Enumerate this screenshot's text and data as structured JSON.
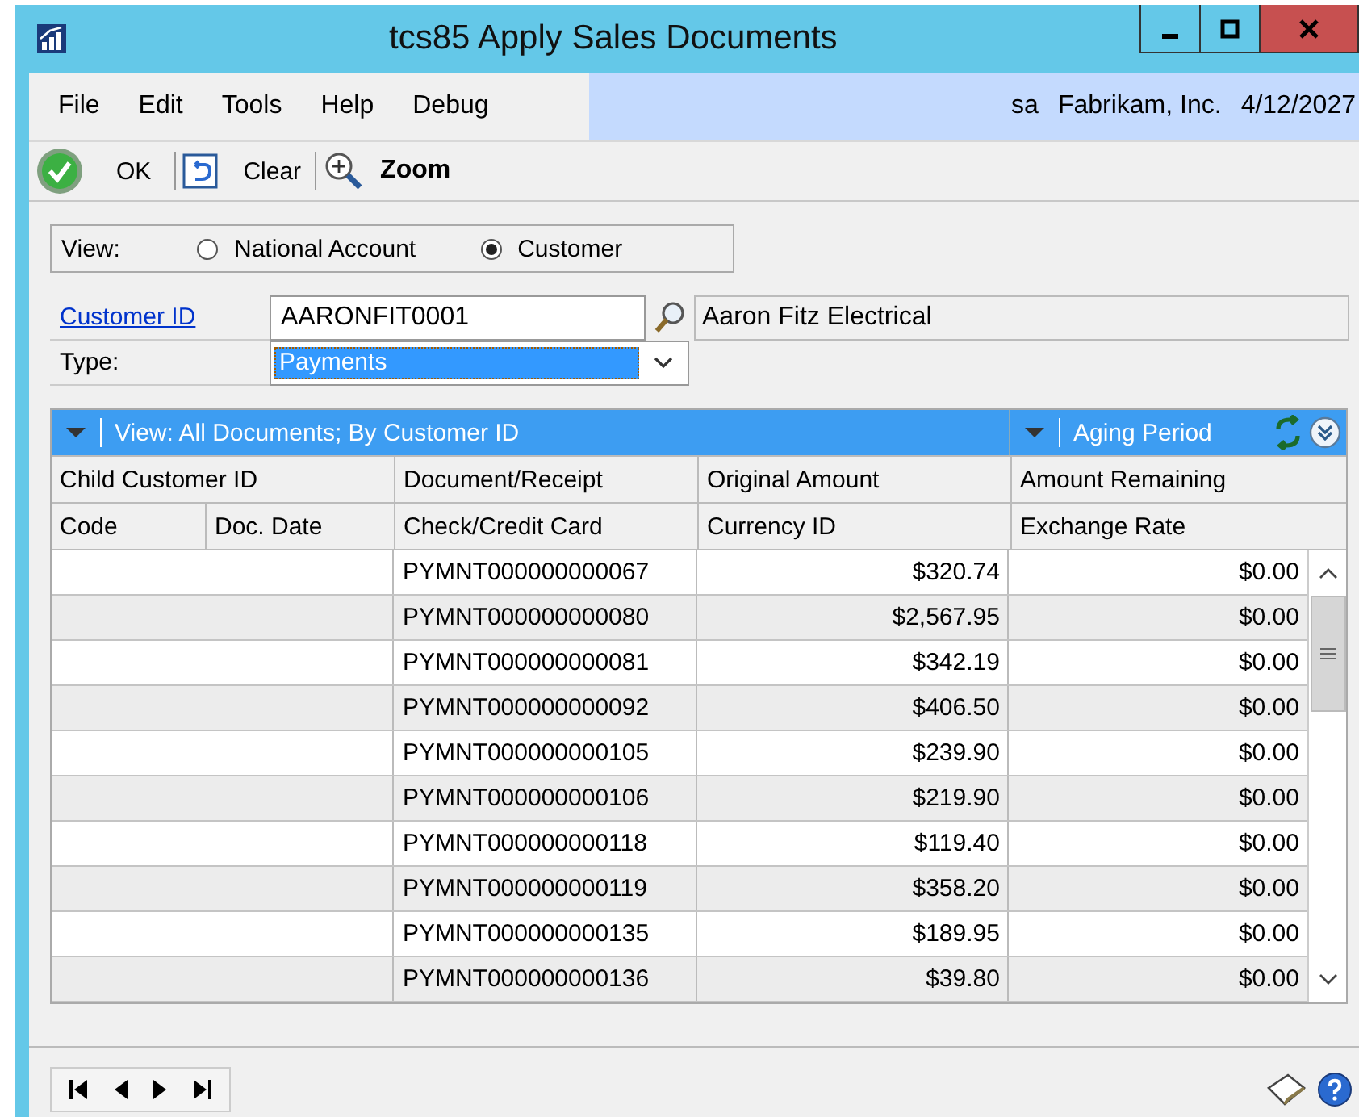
{
  "window": {
    "title": "tcs85 Apply Sales Documents"
  },
  "menu": [
    "File",
    "Edit",
    "Tools",
    "Help",
    "Debug"
  ],
  "status": {
    "user": "sa",
    "company": "Fabrikam, Inc.",
    "date": "4/12/2027"
  },
  "toolbar": [
    {
      "kind": "ok",
      "label": "OK"
    },
    {
      "kind": "clear",
      "label": "Clear"
    },
    {
      "kind": "zoom",
      "label": "Zoom"
    }
  ],
  "view": {
    "label": "View:",
    "options": [
      {
        "label": "National Account",
        "selected": false
      },
      {
        "label": "Customer",
        "selected": true
      }
    ]
  },
  "customer": {
    "label": "Customer ID",
    "value": "AARONFIT0001",
    "name": "Aaron Fitz Electrical"
  },
  "type": {
    "label": "Type:",
    "value": "Payments"
  },
  "grid": {
    "view_label": "View: All Documents; By Customer ID",
    "aging_label": "Aging Period",
    "header_1": [
      "Child Customer ID",
      "Document/Receipt",
      "Original Amount",
      "Amount Remaining"
    ],
    "header_2": [
      "Code",
      "Doc. Date",
      "Check/Credit Card",
      "Currency ID",
      "Exchange Rate"
    ],
    "rows": [
      {
        "document": "PYMNT000000000067",
        "original": "$320.74",
        "remaining": "$0.00"
      },
      {
        "document": "PYMNT000000000080",
        "original": "$2,567.95",
        "remaining": "$0.00"
      },
      {
        "document": "PYMNT000000000081",
        "original": "$342.19",
        "remaining": "$0.00"
      },
      {
        "document": "PYMNT000000000092",
        "original": "$406.50",
        "remaining": "$0.00"
      },
      {
        "document": "PYMNT000000000105",
        "original": "$239.90",
        "remaining": "$0.00"
      },
      {
        "document": "PYMNT000000000106",
        "original": "$219.90",
        "remaining": "$0.00"
      },
      {
        "document": "PYMNT000000000118",
        "original": "$119.40",
        "remaining": "$0.00"
      },
      {
        "document": "PYMNT000000000119",
        "original": "$358.20",
        "remaining": "$0.00"
      },
      {
        "document": "PYMNT000000000135",
        "original": "$189.95",
        "remaining": "$0.00"
      },
      {
        "document": "PYMNT000000000136",
        "original": "$39.80",
        "remaining": "$0.00"
      }
    ]
  }
}
